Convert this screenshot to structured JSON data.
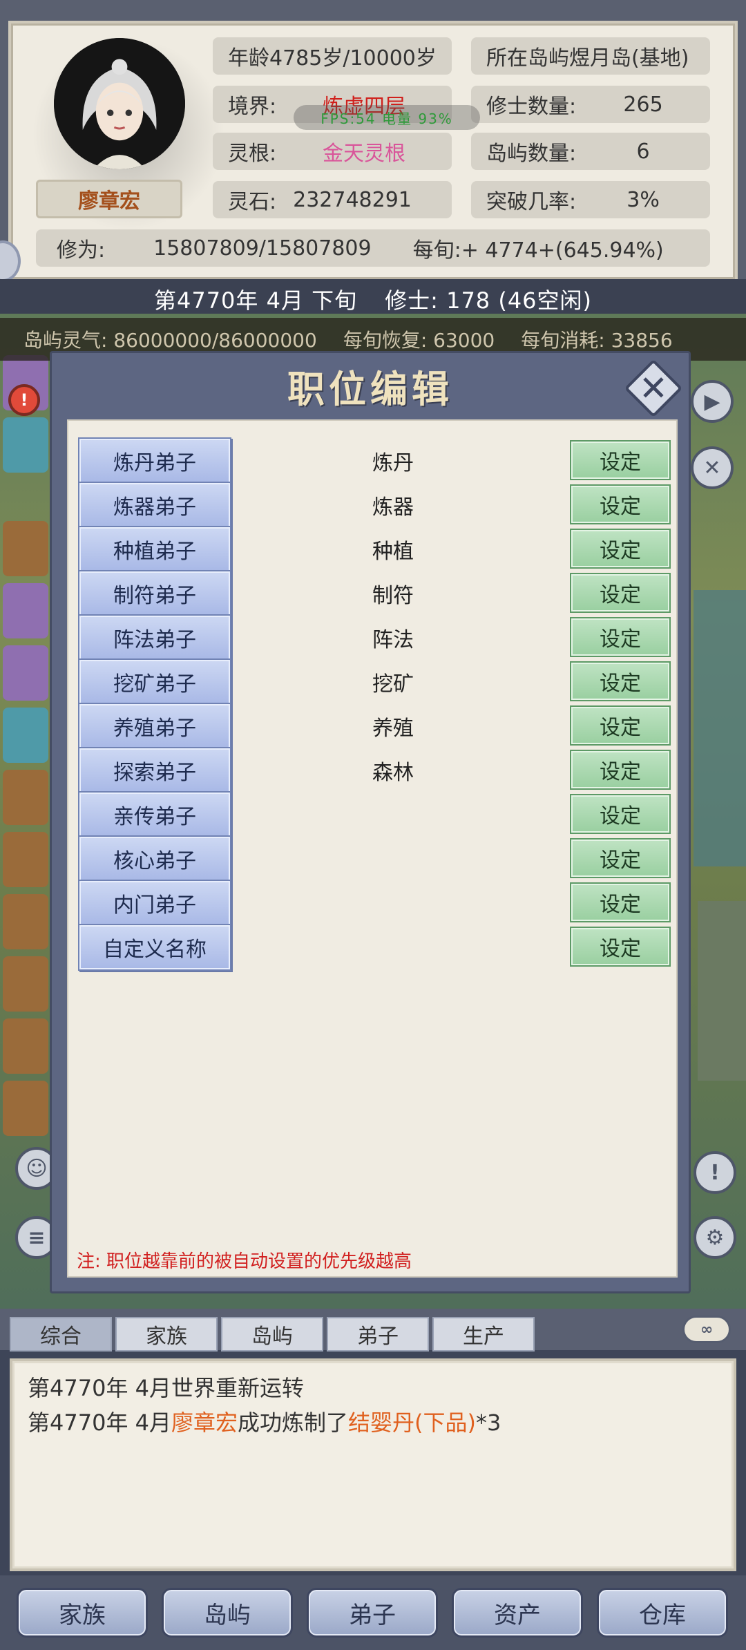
{
  "character": {
    "name": "廖章宏",
    "age_label": "年龄4785岁/10000岁",
    "island_label": "所在岛屿煜月岛(基地)",
    "realm_label": "境界:",
    "realm_value": "炼虚四层",
    "cultivator_count_label": "修士数量:",
    "cultivator_count_value": "265",
    "root_label": "灵根:",
    "root_value": "金天灵根",
    "island_count_label": "岛屿数量:",
    "island_count_value": "6",
    "stones_label": "灵石:",
    "stones_value": "232748291",
    "breakthrough_label": "突破几率:",
    "breakthrough_value": "3%",
    "cultivation_label": "修为:",
    "cultivation_value": "15807809/15807809",
    "per_period_label": "每旬:+ 4774+(645.94%)"
  },
  "overlay": {
    "fps": "FPS:54  电量 93%"
  },
  "time_bar": {
    "date": "第4770年 4月 下旬",
    "cultivators": "修士: 178 (46空闲)"
  },
  "qi_bar": {
    "qi": "岛屿灵气: 86000000/86000000",
    "recovery": "每旬恢复: 63000",
    "consumption": "每旬消耗: 33856"
  },
  "modal": {
    "title": "职位编辑",
    "set_label": "设定",
    "note": "注: 职位越靠前的被自动设置的优先级越高",
    "rows": [
      {
        "role": "炼丹弟子",
        "value": "炼丹"
      },
      {
        "role": "炼器弟子",
        "value": "炼器"
      },
      {
        "role": "种植弟子",
        "value": "种植"
      },
      {
        "role": "制符弟子",
        "value": "制符"
      },
      {
        "role": "阵法弟子",
        "value": "阵法"
      },
      {
        "role": "挖矿弟子",
        "value": "挖矿"
      },
      {
        "role": "养殖弟子",
        "value": "养殖"
      },
      {
        "role": "探索弟子",
        "value": "森林"
      },
      {
        "role": "亲传弟子",
        "value": ""
      },
      {
        "role": "核心弟子",
        "value": ""
      },
      {
        "role": "内门弟子",
        "value": ""
      },
      {
        "role": "自定义名称",
        "value": ""
      }
    ]
  },
  "log_tabs": [
    "综合",
    "家族",
    "岛屿",
    "弟子",
    "生产"
  ],
  "log": {
    "line1": "第4770年 4月世界重新运转",
    "line2_prefix": "第4770年 4月",
    "line2_name": "廖章宏",
    "line2_mid": "成功炼制了",
    "line2_item": "结婴丹(下品)",
    "line2_suffix": "*3"
  },
  "bottom_nav": [
    "家族",
    "岛屿",
    "弟子",
    "资产",
    "仓库"
  ],
  "colors": {
    "realm": "#d0201c",
    "root": "#d9559a",
    "note": "#d11f1f",
    "highlight": "#e0601e"
  }
}
